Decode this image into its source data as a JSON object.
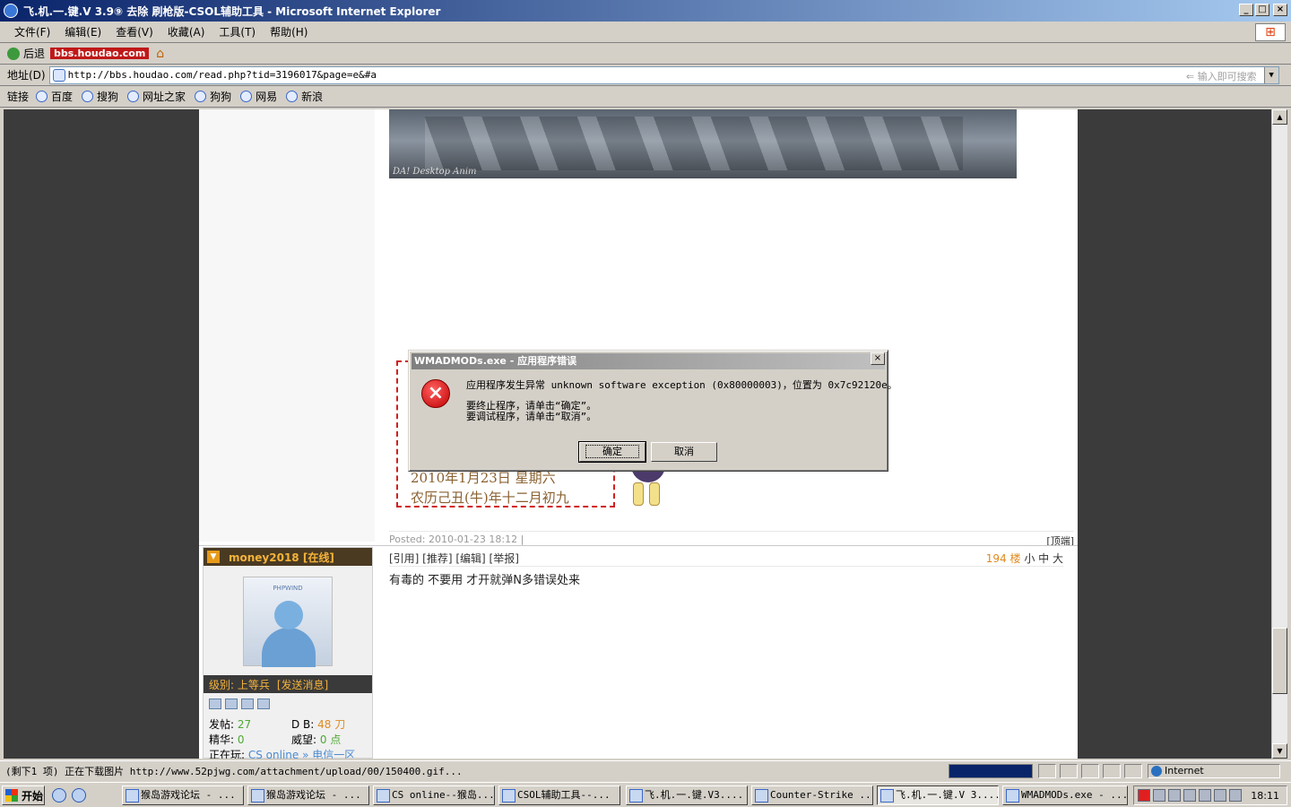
{
  "window": {
    "title": "飞.机.一.键.V 3.9⑨ 去除 刷枪版-CSOL辅助工具 - Microsoft Internet Explorer"
  },
  "menu": {
    "items": [
      "文件(F)",
      "编辑(E)",
      "查看(V)",
      "收藏(A)",
      "工具(T)",
      "帮助(H)"
    ]
  },
  "toolbar": {
    "back_label": "后退",
    "watermark": "bbs.houdao.com"
  },
  "address": {
    "label": "地址(D)",
    "url": "http://bbs.houdao.com/read.php?tid=3196017&page=e&#a",
    "search_placeholder": "⇐ 输入即可搜索"
  },
  "links": {
    "label": "链接",
    "items": [
      "百度",
      "搜狗",
      "网址之家",
      "狗狗",
      "网易",
      "新浪"
    ]
  },
  "post_image": {
    "caption": "DA! Desktop Anim"
  },
  "calendar": {
    "date_line": "2010年1月23日 星期六",
    "lunar_line": "农历己丑(牛)年十二月初九"
  },
  "post": {
    "posted": "Posted: 2010-01-23 18:12 |",
    "top_link": "[顶端]",
    "actions": "[引用] [推荐] [编辑] [举报]",
    "floor_number": "194 楼",
    "font_sizes": "小 中 大",
    "content": "有毒的 不要用 才开就弹N多错误处来"
  },
  "user": {
    "name": "money2018 [在线]",
    "avatar_brand": "PHPWIND",
    "level_label": "级别: 上等兵",
    "send_message": "[发送消息]",
    "posts_label": "发帖:",
    "posts_value": "27",
    "db_label": "D B:",
    "db_value": "48 刀",
    "elite_label": "精华:",
    "elite_value": "0",
    "prestige_label": "威望:",
    "prestige_value": "0 点",
    "playing_label": "正在玩:",
    "playing_value": "CS online » 电信一区"
  },
  "dialog": {
    "title": "WMADMODs.exe - 应用程序错误",
    "message": "应用程序发生异常 unknown software exception (0x80000003)，位置为 0x7c92120e。",
    "line_terminate": "要终止程序，请单击“确定”。",
    "line_debug": "要调试程序，请单击“取消”。",
    "ok_label": "确定",
    "cancel_label": "取消"
  },
  "status": {
    "text": "(剩下1 项) 正在下载图片 http://www.52pjwg.com/attachment/upload/00/150400.gif...",
    "zone": "Internet",
    "progress": 1.0
  },
  "taskbar": {
    "start_label": "开始",
    "tasks": [
      "猴岛游戏论坛 - ...",
      "猴岛游戏论坛 - ...",
      "CS online--猴岛...",
      "CSOL辅助工具--...",
      "飞.机.一.键.V3....",
      "Counter-Strike ...",
      "飞.机.一.键.V 3....",
      "WMADMODs.exe - ..."
    ],
    "clock": "18:11"
  }
}
